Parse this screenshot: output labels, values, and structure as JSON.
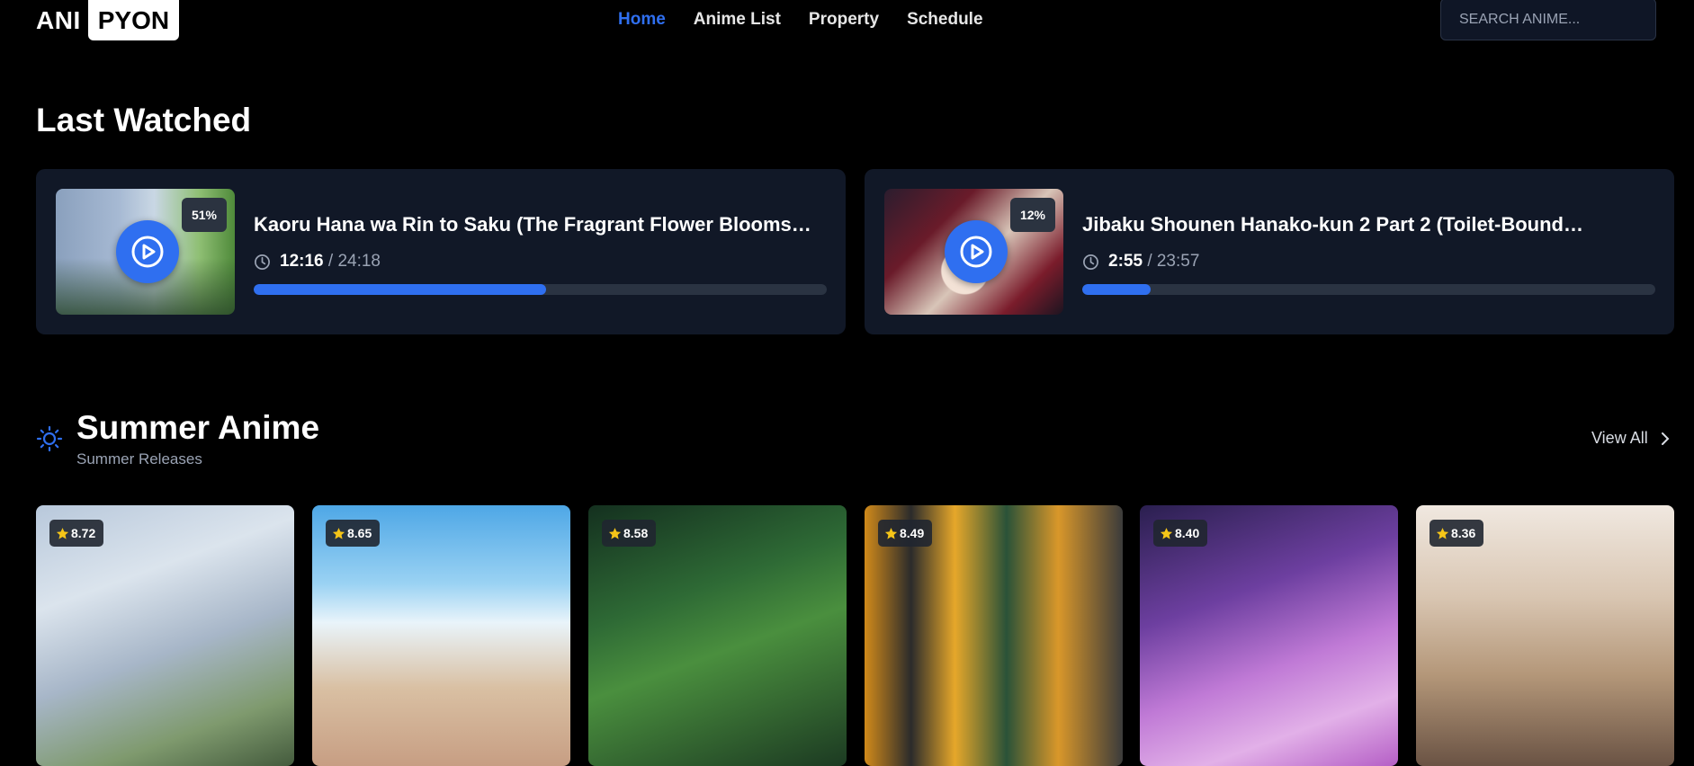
{
  "logo": {
    "left": "ANI",
    "right": "PYON"
  },
  "nav": {
    "items": [
      {
        "label": "Home",
        "active": true
      },
      {
        "label": "Anime List",
        "active": false
      },
      {
        "label": "Property",
        "active": false
      },
      {
        "label": "Schedule",
        "active": false
      }
    ]
  },
  "search": {
    "placeholder": "SEARCH ANIME..."
  },
  "last_watched": {
    "title": "Last Watched",
    "items": [
      {
        "title": "Kaoru Hana wa Rin to Saku (The Fragrant Flower Blooms…",
        "percent_label": "51%",
        "progress": 0.51,
        "current": "12:16",
        "total": "/ 24:18"
      },
      {
        "title": "Jibaku Shounen Hanako-kun 2 Part 2 (Toilet-Bound…",
        "percent_label": "12%",
        "progress": 0.12,
        "current": "2:55",
        "total": "/ 23:57"
      }
    ]
  },
  "summer": {
    "title": "Summer Anime",
    "subtitle": "Summer Releases",
    "view_all": "View All",
    "cards": [
      {
        "rating": "8.72"
      },
      {
        "rating": "8.65"
      },
      {
        "rating": "8.58"
      },
      {
        "rating": "8.49"
      },
      {
        "rating": "8.40"
      },
      {
        "rating": "8.36"
      }
    ]
  },
  "colors": {
    "accent": "#2f6ff0",
    "card_bg": "#111827",
    "star": "#f5c518"
  },
  "icons": {
    "clock": "clock-icon",
    "play": "play-icon",
    "sun": "sun-icon",
    "star": "star-icon",
    "chevron": "chevron-right-icon"
  }
}
